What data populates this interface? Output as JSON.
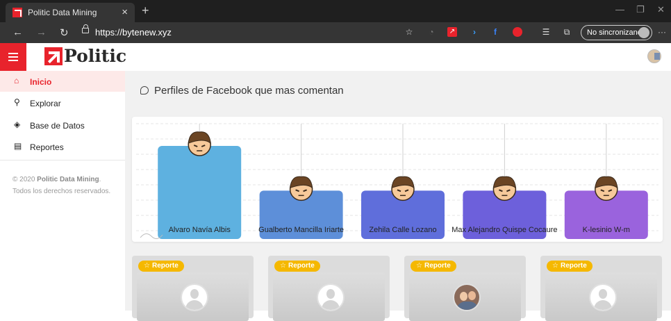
{
  "browser": {
    "tab_title": "Politic Data Mining",
    "tab_close": "×",
    "new_tab": "+",
    "url": "https://bytenew.xyz",
    "profile_label": "No sincronizando",
    "more": "···",
    "window_controls": [
      "—",
      "❐",
      "✕"
    ]
  },
  "app": {
    "logo_text": "Politic",
    "menu_icon": "hamburger-icon"
  },
  "sidebar": {
    "items": [
      {
        "label": "Inicio",
        "icon": "home-icon",
        "glyph": "⌂",
        "active": true
      },
      {
        "label": "Explorar",
        "icon": "search-icon",
        "glyph": "⚲",
        "active": false
      },
      {
        "label": "Base de Datos",
        "icon": "layers-icon",
        "glyph": "◈",
        "active": false
      },
      {
        "label": "Reportes",
        "icon": "clipboard-icon",
        "glyph": "▤",
        "active": false
      }
    ],
    "copyright_prefix": "© 2020 ",
    "copyright_brand": "Politic Data Mining",
    "copyright_suffix": ". Todos los derechos reservados."
  },
  "main": {
    "section_title": "Perfiles de Facebook que mas comentan",
    "report_badge": "Reporte",
    "report_cards": [
      {
        "avatar": "placeholder"
      },
      {
        "avatar": "placeholder"
      },
      {
        "avatar": "photo"
      },
      {
        "avatar": "placeholder"
      }
    ]
  },
  "chart_data": {
    "type": "bar",
    "categories": [
      "Alvaro Navía Albis",
      "Gualberto Mancilla Iriarte",
      "Zehila Calle Lozano",
      "Max Alejandro Quispe Cocaure",
      "K-lesinio W-m"
    ],
    "values": [
      100,
      52,
      52,
      52,
      52
    ],
    "colors": [
      "#5eb1e0",
      "#5d8fd9",
      "#5f6edb",
      "#6d60db",
      "#9a63dd"
    ],
    "ylim": [
      0,
      100
    ],
    "grid": true,
    "title": "",
    "xlabel": "",
    "ylabel": ""
  },
  "colors": {
    "brand": "#e8232c",
    "badge": "#f5b800",
    "active_bg": "#fde9e8"
  }
}
